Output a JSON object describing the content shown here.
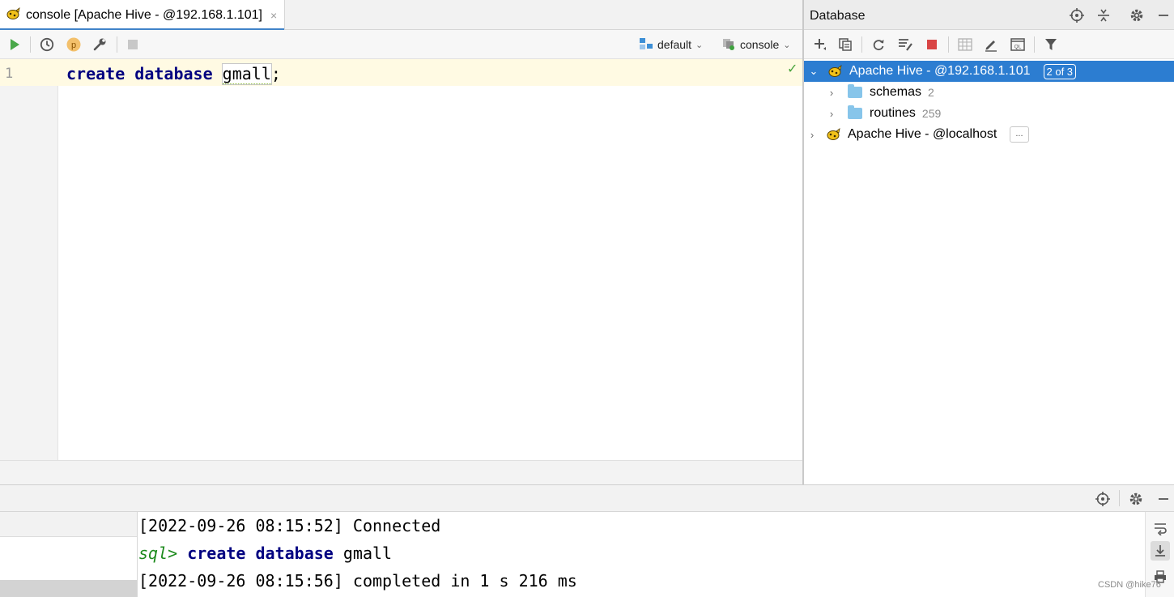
{
  "editor": {
    "tab_title": "console [Apache Hive - @192.168.1.101]",
    "tab_close": "×",
    "schema_combo": "default",
    "session_combo": "console",
    "line_number": "1",
    "code": {
      "kw1": "create",
      "kw2": "database",
      "ident": "gmall",
      "tail": ";"
    },
    "check": "✓"
  },
  "database": {
    "title": "Database",
    "tree": [
      {
        "label": "Apache Hive - @192.168.1.101",
        "badge": "2 of 3",
        "expanded": true,
        "selected": true
      },
      {
        "label": "schemas",
        "count": "2"
      },
      {
        "label": "routines",
        "count": "259"
      },
      {
        "label": "Apache Hive - @localhost",
        "more": "..."
      }
    ]
  },
  "output": {
    "line1": "[2022-09-26 08:15:52] Connected",
    "prompt": "sql>",
    "cmd_kw1": "create",
    "cmd_kw2": "database",
    "cmd_ident": "gmall",
    "line3": "[2022-09-26 08:15:56] completed in 1 s 216 ms"
  },
  "watermark": "CSDN @hike76",
  "colors": {
    "selection": "#2c7dd1",
    "keyword": "#000080",
    "prompt": "#1c8a1c",
    "run": "#4aa84a",
    "stop": "#d94545"
  }
}
